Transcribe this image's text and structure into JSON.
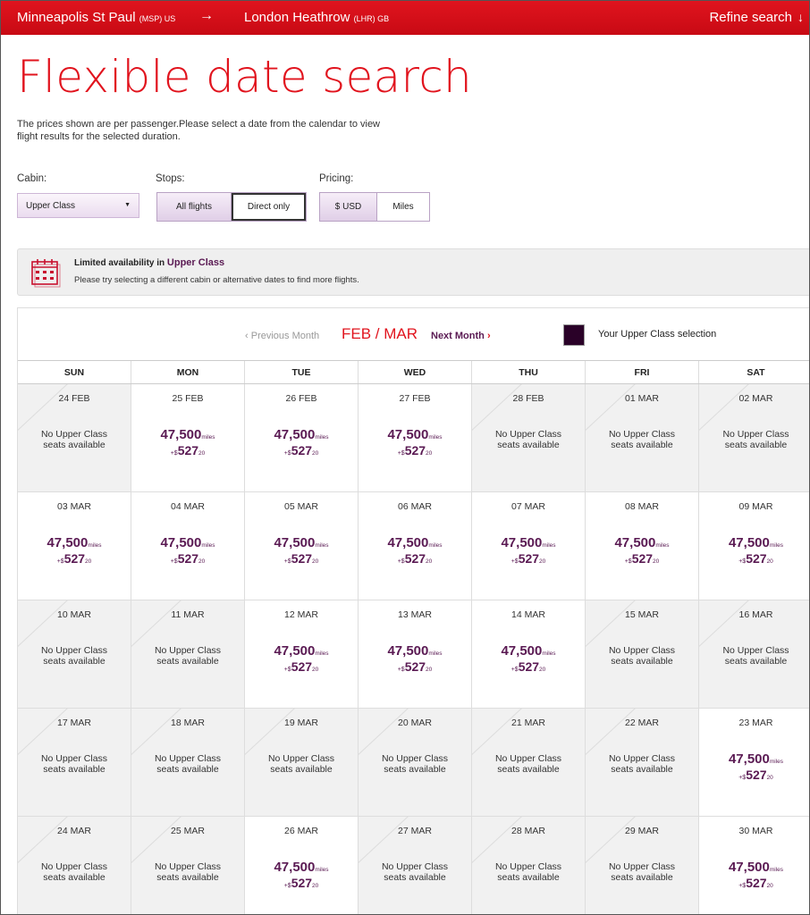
{
  "topbar": {
    "origin": "Minneapolis St Paul",
    "origin_code": "(MSP) US",
    "arrow": "→",
    "destination": "London Heathrow",
    "destination_code": "(LHR) GB",
    "refine": "Refine search",
    "refine_icon": "↓"
  },
  "title": "Flexible date search",
  "intro": "The prices shown are per passenger.Please select a date from the calendar to view flight results for the selected duration.",
  "filters": {
    "cabin_label": "Cabin:",
    "cabin_value": "Upper Class",
    "stops_label": "Stops:",
    "stops_options": [
      "All flights",
      "Direct only"
    ],
    "pricing_label": "Pricing:",
    "pricing_options": [
      "$ USD",
      "Miles"
    ]
  },
  "alert": {
    "title_prefix": "Limited availability in",
    "title_class": "Upper Class",
    "message": "Please try selecting a different cabin or alternative dates to find more flights."
  },
  "calendar": {
    "prev_label": "Previous Month",
    "month_label": "FEB / MAR",
    "next_label": "Next Month",
    "legend": "Your Upper Class selection",
    "weekdays": [
      "SUN",
      "MON",
      "TUE",
      "WED",
      "THU",
      "FRI",
      "SAT"
    ],
    "na_text_1": "No Upper Class",
    "na_text_2": "seats available",
    "miles_unit": "miles",
    "price_prefix": "+$",
    "days": [
      {
        "date": "24 FEB",
        "available": false
      },
      {
        "date": "25 FEB",
        "available": true,
        "miles": "47,500",
        "price": "527",
        "cents": "20"
      },
      {
        "date": "26 FEB",
        "available": true,
        "miles": "47,500",
        "price": "527",
        "cents": "20"
      },
      {
        "date": "27 FEB",
        "available": true,
        "miles": "47,500",
        "price": "527",
        "cents": "20"
      },
      {
        "date": "28 FEB",
        "available": false
      },
      {
        "date": "01 MAR",
        "available": false
      },
      {
        "date": "02 MAR",
        "available": false
      },
      {
        "date": "03 MAR",
        "available": true,
        "miles": "47,500",
        "price": "527",
        "cents": "20"
      },
      {
        "date": "04 MAR",
        "available": true,
        "miles": "47,500",
        "price": "527",
        "cents": "20"
      },
      {
        "date": "05 MAR",
        "available": true,
        "miles": "47,500",
        "price": "527",
        "cents": "20"
      },
      {
        "date": "06 MAR",
        "available": true,
        "miles": "47,500",
        "price": "527",
        "cents": "20"
      },
      {
        "date": "07 MAR",
        "available": true,
        "miles": "47,500",
        "price": "527",
        "cents": "20"
      },
      {
        "date": "08 MAR",
        "available": true,
        "miles": "47,500",
        "price": "527",
        "cents": "20"
      },
      {
        "date": "09 MAR",
        "available": true,
        "miles": "47,500",
        "price": "527",
        "cents": "20"
      },
      {
        "date": "10 MAR",
        "available": false
      },
      {
        "date": "11 MAR",
        "available": false
      },
      {
        "date": "12 MAR",
        "available": true,
        "miles": "47,500",
        "price": "527",
        "cents": "20"
      },
      {
        "date": "13 MAR",
        "available": true,
        "miles": "47,500",
        "price": "527",
        "cents": "20"
      },
      {
        "date": "14 MAR",
        "available": true,
        "miles": "47,500",
        "price": "527",
        "cents": "20"
      },
      {
        "date": "15 MAR",
        "available": false
      },
      {
        "date": "16 MAR",
        "available": false
      },
      {
        "date": "17 MAR",
        "available": false
      },
      {
        "date": "18 MAR",
        "available": false
      },
      {
        "date": "19 MAR",
        "available": false
      },
      {
        "date": "20 MAR",
        "available": false
      },
      {
        "date": "21 MAR",
        "available": false
      },
      {
        "date": "22 MAR",
        "available": false
      },
      {
        "date": "23 MAR",
        "available": true,
        "miles": "47,500",
        "price": "527",
        "cents": "20"
      },
      {
        "date": "24 MAR",
        "available": false
      },
      {
        "date": "25 MAR",
        "available": false
      },
      {
        "date": "26 MAR",
        "available": true,
        "miles": "47,500",
        "price": "527",
        "cents": "20"
      },
      {
        "date": "27 MAR",
        "available": false
      },
      {
        "date": "28 MAR",
        "available": false
      },
      {
        "date": "29 MAR",
        "available": false
      },
      {
        "date": "30 MAR",
        "available": true,
        "miles": "47,500",
        "price": "527",
        "cents": "20"
      }
    ]
  },
  "colors": {
    "brand_red": "#e1141e",
    "brand_purple": "#5a1a53",
    "legend_swatch": "#2a0128"
  }
}
